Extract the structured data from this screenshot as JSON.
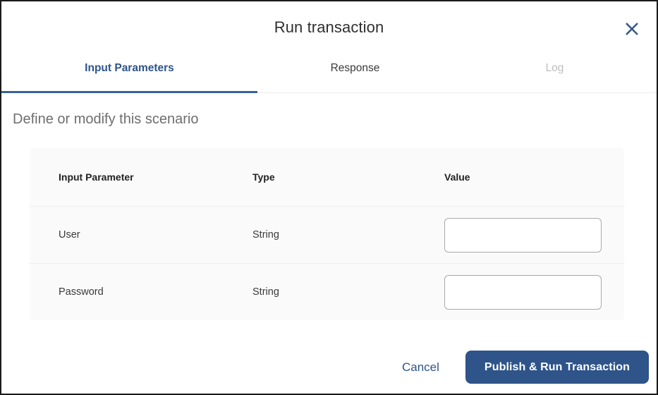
{
  "dialog": {
    "title": "Run transaction",
    "close_icon": "close-icon",
    "subtitle": "Define or modify this scenario"
  },
  "tabs": [
    {
      "label": "Input Parameters",
      "state": "active"
    },
    {
      "label": "Response",
      "state": "normal"
    },
    {
      "label": "Log",
      "state": "disabled"
    }
  ],
  "table": {
    "headers": {
      "parameter": "Input Parameter",
      "type": "Type",
      "value": "Value"
    },
    "rows": [
      {
        "parameter": "User",
        "type": "String",
        "value": "",
        "placeholder": ""
      },
      {
        "parameter": "Password",
        "type": "String",
        "value": "",
        "placeholder": ""
      }
    ]
  },
  "footer": {
    "cancel_label": "Cancel",
    "primary_label": "Publish & Run Transaction"
  },
  "colors": {
    "accent_blue": "#2e5489",
    "tab_underline": "#36619b",
    "close_icon": "#3a5c87",
    "card_bg": "#fafafa",
    "input_border": "#a9a9a9",
    "subtitle_gray": "#6e6e6e",
    "disabled_gray": "#bdbdbd"
  }
}
